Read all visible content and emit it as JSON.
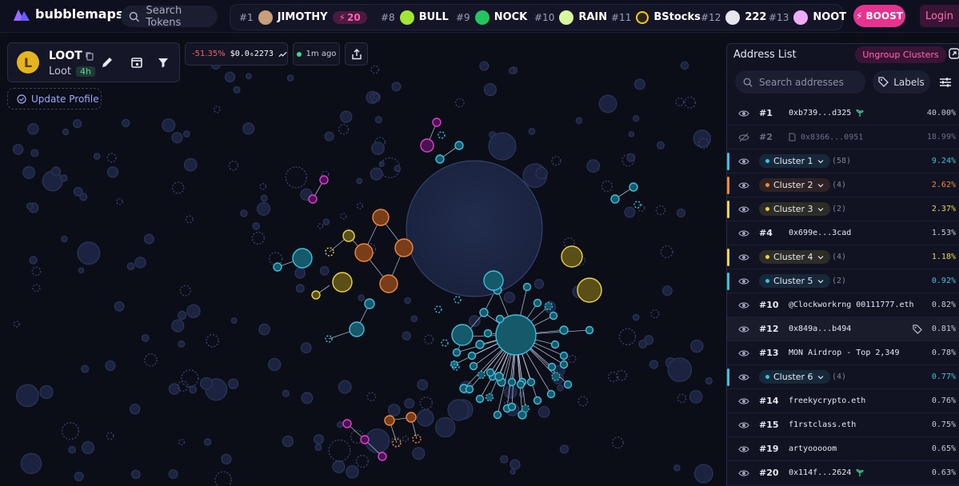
{
  "brand": {
    "name": "bubblemaps",
    "accent": "#e6338f"
  },
  "topbar": {
    "search_label": "Search Tokens",
    "trending": [
      {
        "rank": "#1",
        "name": "JIMOTHY",
        "boost": "20",
        "avatar_color": "#c7a07a"
      },
      {
        "rank": "#8",
        "name": "BULL",
        "avatar_color": "#a3e635"
      },
      {
        "rank": "#9",
        "name": "NOCK",
        "avatar_color": "#22c55e"
      },
      {
        "rank": "#10",
        "name": "RAIN",
        "avatar_color": "#d9f99d"
      },
      {
        "rank": "#11",
        "name": "BStocks",
        "avatar_color": "#facc15"
      },
      {
        "rank": "#12",
        "name": "222",
        "avatar_color": "#e5e7eb"
      },
      {
        "rank": "#13",
        "name": "NOOT",
        "avatar_color": "#f0abfc"
      }
    ],
    "boost_label": "BOOST",
    "login_label": "Login"
  },
  "token": {
    "avatar_letter": "L",
    "symbol": "LOOT",
    "name": "Loot",
    "age": "4h",
    "update_profile_label": "Update Profile",
    "price_change": "-51.35%",
    "price": "$0.0₆2273",
    "updated": "1m ago"
  },
  "panel": {
    "title": "Address List",
    "ungroup_label": "Ungroup Clusters",
    "search_placeholder": "Search addresses",
    "labels_button": "Labels",
    "rows": [
      {
        "kind": "addr",
        "rank": "#1",
        "label": "0xb739...d325",
        "pct": "40.00%",
        "sprout": true
      },
      {
        "kind": "addr",
        "rank": "#2",
        "label": "0x8366...0951",
        "pct": "18.99%",
        "hidden": true,
        "doc": true
      },
      {
        "kind": "cluster",
        "label": "Cluster 1",
        "count": "(58)",
        "pct": "9.24%",
        "color": "#3fbfdd"
      },
      {
        "kind": "cluster",
        "label": "Cluster 2",
        "count": "(4)",
        "pct": "2.62%",
        "color": "#f0883e"
      },
      {
        "kind": "cluster",
        "label": "Cluster 3",
        "count": "(2)",
        "pct": "2.37%",
        "color": "#e8d44d"
      },
      {
        "kind": "addr",
        "rank": "#4",
        "label": "0x699e...3cad",
        "pct": "1.53%"
      },
      {
        "kind": "cluster",
        "label": "Cluster 4",
        "count": "(4)",
        "pct": "1.18%",
        "color": "#e8d44d"
      },
      {
        "kind": "cluster",
        "label": "Cluster 5",
        "count": "(2)",
        "pct": "0.92%",
        "color": "#3fbfdd"
      },
      {
        "kind": "addr",
        "rank": "#10",
        "label": "@Clockworkrng 00111777.eth",
        "pct": "0.82%"
      },
      {
        "kind": "addr",
        "rank": "#12",
        "label": "0x849a...b494",
        "pct": "0.81%",
        "tag": true,
        "highlight": true
      },
      {
        "kind": "addr",
        "rank": "#13",
        "label": "MON Airdrop - Top 2,349",
        "pct": "0.78%"
      },
      {
        "kind": "cluster",
        "label": "Cluster 6",
        "count": "(4)",
        "pct": "0.77%",
        "color": "#3fbfdd"
      },
      {
        "kind": "addr",
        "rank": "#14",
        "label": "freekycrypto.eth",
        "pct": "0.76%"
      },
      {
        "kind": "addr",
        "rank": "#15",
        "label": "f1rstclass.eth",
        "pct": "0.75%"
      },
      {
        "kind": "addr",
        "rank": "#19",
        "label": "artyooooom",
        "pct": "0.65%"
      },
      {
        "kind": "addr",
        "rank": "#20",
        "label": "0x114f...2624",
        "pct": "0.63%",
        "sprout": true
      }
    ]
  }
}
